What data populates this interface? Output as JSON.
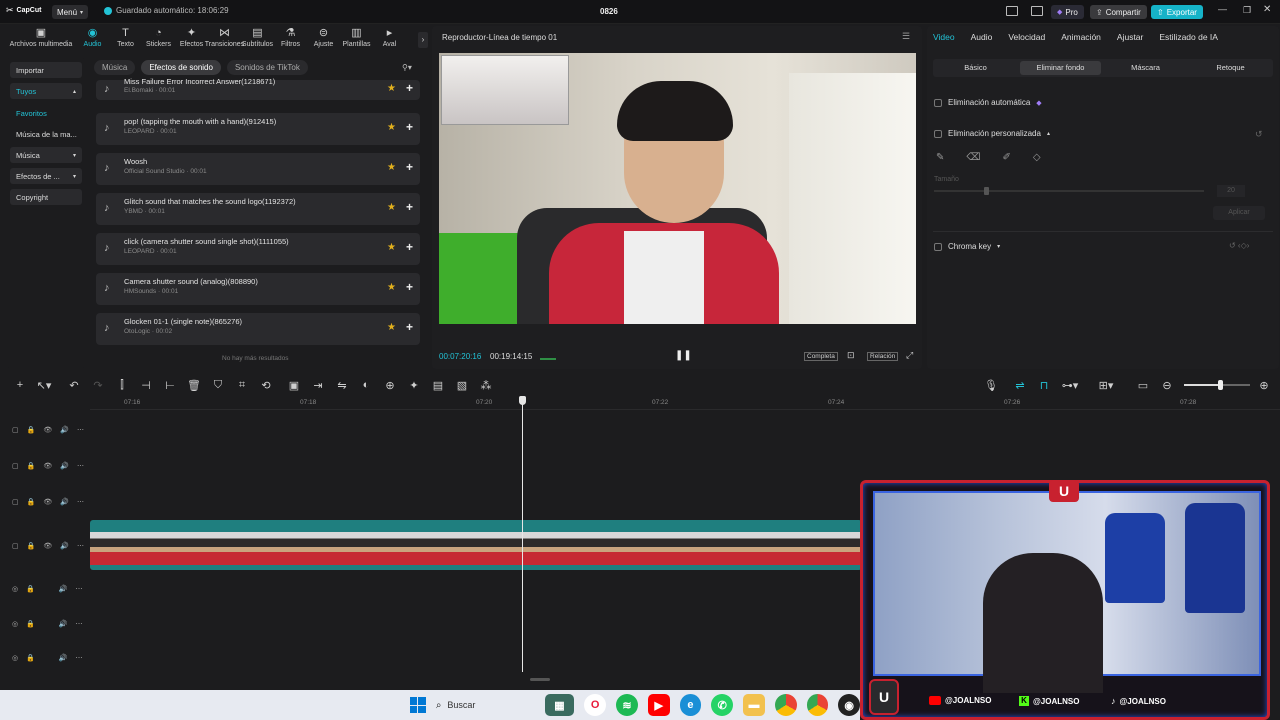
{
  "app": {
    "logo": "CapCut",
    "menu": "Menú",
    "autosave": "Guardado automático: 18:06:29",
    "project": "0826",
    "pro": "Pro",
    "share": "Compartir",
    "export": "Exportar"
  },
  "nav": [
    {
      "label": "Archivos multimedia",
      "icon": "media-icon"
    },
    {
      "label": "Audio",
      "icon": "audio-icon"
    },
    {
      "label": "Texto",
      "icon": "text-icon"
    },
    {
      "label": "Stickers",
      "icon": "sticker-icon"
    },
    {
      "label": "Efectos",
      "icon": "effects-icon"
    },
    {
      "label": "Transiciones",
      "icon": "transition-icon"
    },
    {
      "label": "Subtítulos",
      "icon": "subtitle-icon"
    },
    {
      "label": "Filtros",
      "icon": "filter-icon"
    },
    {
      "label": "Ajuste",
      "icon": "adjust-icon"
    },
    {
      "label": "Plantillas",
      "icon": "template-icon"
    },
    {
      "label": "Aval",
      "icon": "avatar-icon"
    }
  ],
  "sidebar": [
    {
      "label": "Importar"
    },
    {
      "label": "Tuyos"
    },
    {
      "label": "Favoritos"
    },
    {
      "label": "Música de la ma..."
    },
    {
      "label": "Música"
    },
    {
      "label": "Efectos de ..."
    },
    {
      "label": "Copyright"
    }
  ],
  "audio_tabs": [
    "Música",
    "Efectos de sonido",
    "Sonidos de TikTok"
  ],
  "sounds": [
    {
      "title": "Miss Failure Error Incorrect Answer(1218671)",
      "meta": "El.Bomaki · 00:01"
    },
    {
      "title": "pop! (tapping the mouth with a hand)(912415)",
      "meta": "LEOPARD · 00:01"
    },
    {
      "title": "Woosh",
      "meta": "Official Sound Studio · 00:01"
    },
    {
      "title": "Glitch sound that matches the sound logo(1192372)",
      "meta": "YBMD · 00:01"
    },
    {
      "title": "click (camera shutter sound single shot)(1111055)",
      "meta": "LEOPARD · 00:01"
    },
    {
      "title": "Camera shutter sound (analog)(808890)",
      "meta": "HMSounds · 00:01"
    },
    {
      "title": "Glocken 01-1 (single note)(865276)",
      "meta": "OtoLogic · 00:02"
    }
  ],
  "no_more": "No hay más resultados",
  "player": {
    "title": "Reproductor-Línea de tiempo 01",
    "current": "00:07:20:16",
    "total": "00:19:14:15",
    "full": "Completa",
    "ratio": "Relación"
  },
  "right_panel": {
    "tabs": [
      "Video",
      "Audio",
      "Velocidad",
      "Animación",
      "Ajustar",
      "Estilizado de IA"
    ],
    "subtabs": [
      "Básico",
      "Eliminar fondo",
      "Máscara",
      "Retoque"
    ],
    "auto": "Eliminación automática",
    "custom": "Eliminación personalizada",
    "size_label": "Tamaño",
    "size_value": "20",
    "apply": "Aplicar",
    "chroma": "Chroma key"
  },
  "ruler": [
    "07:16",
    "07:18",
    "07:20",
    "07:22",
    "07:24",
    "07:26",
    "07:28"
  ],
  "overlay": {
    "socials": [
      "@JOALNSO",
      "@JOALNSO",
      "@JOALNSO"
    ]
  },
  "taskbar": {
    "search": "Buscar"
  },
  "colors": {
    "accent": "#23c3d6",
    "export": "#16b3c8",
    "clip": "#1f7f7f",
    "star": "#e2b11e"
  }
}
